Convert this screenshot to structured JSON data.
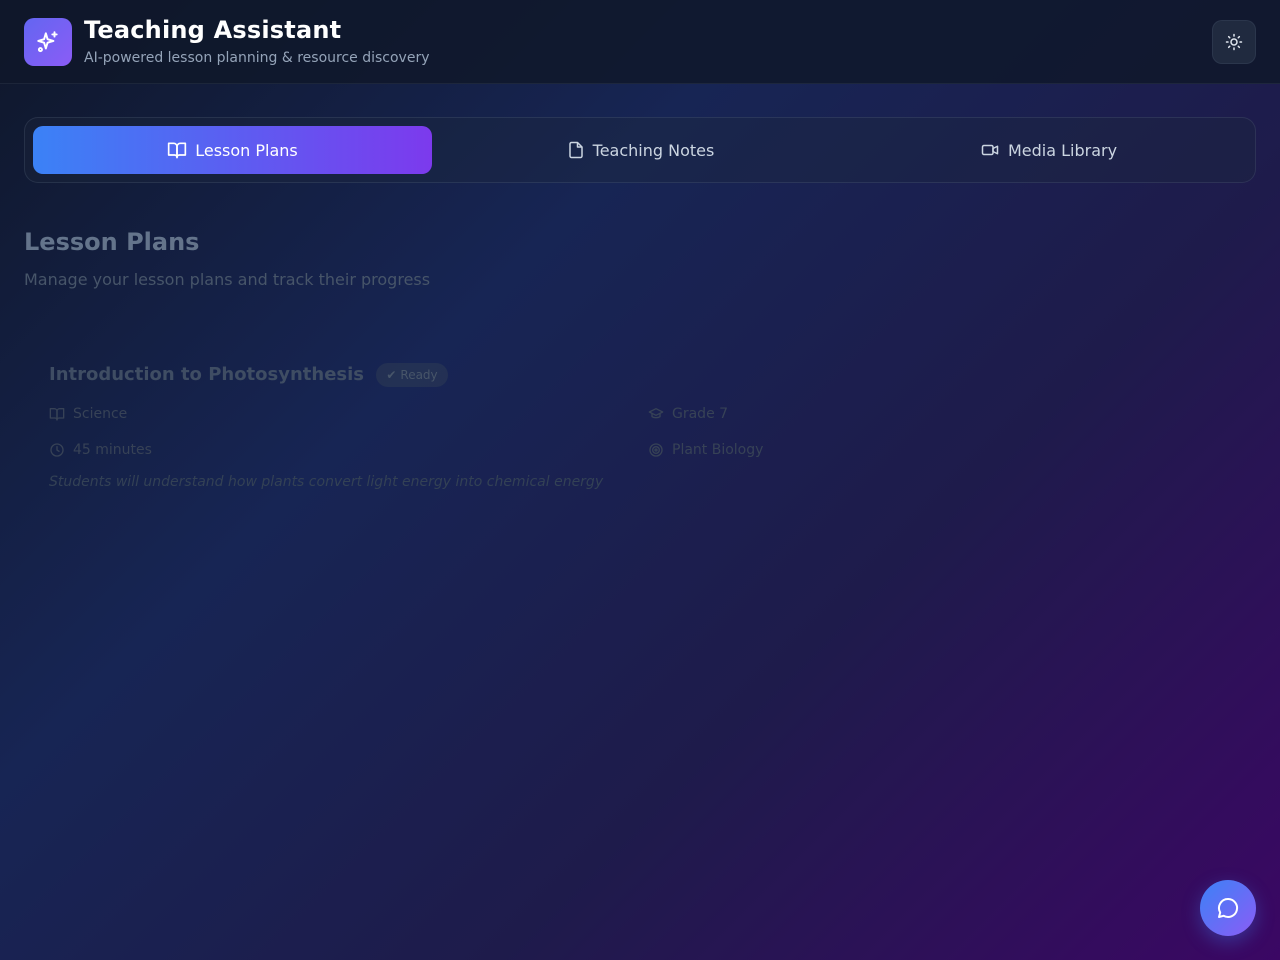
{
  "app": {
    "title": "Teaching Assistant",
    "subtitle": "AI-powered lesson planning & resource discovery",
    "logo_icon": "sparkles-icon",
    "theme_icon": "sun-icon"
  },
  "tabs": [
    {
      "label": "Lesson Plans",
      "icon": "book-open-icon",
      "active": true
    },
    {
      "label": "Teaching Notes",
      "icon": "file-icon",
      "active": false
    },
    {
      "label": "Media Library",
      "icon": "video-icon",
      "active": false
    }
  ],
  "main": {
    "title": "Lesson Plans",
    "subtitle": "Manage your lesson plans and track their progress"
  },
  "lesson": {
    "title": "Introduction to Photosynthesis",
    "status": "Ready",
    "subject": "Science",
    "grade": "Grade 7",
    "duration": "45 minutes",
    "topic": "Plant Biology",
    "objective": "Students will understand how plants convert light energy into chemical energy"
  },
  "chat": {
    "icon": "message-circle-icon"
  },
  "colors": {
    "accent_start": "#3b82f6",
    "accent_end": "#7c3aed",
    "background": "#172554"
  }
}
